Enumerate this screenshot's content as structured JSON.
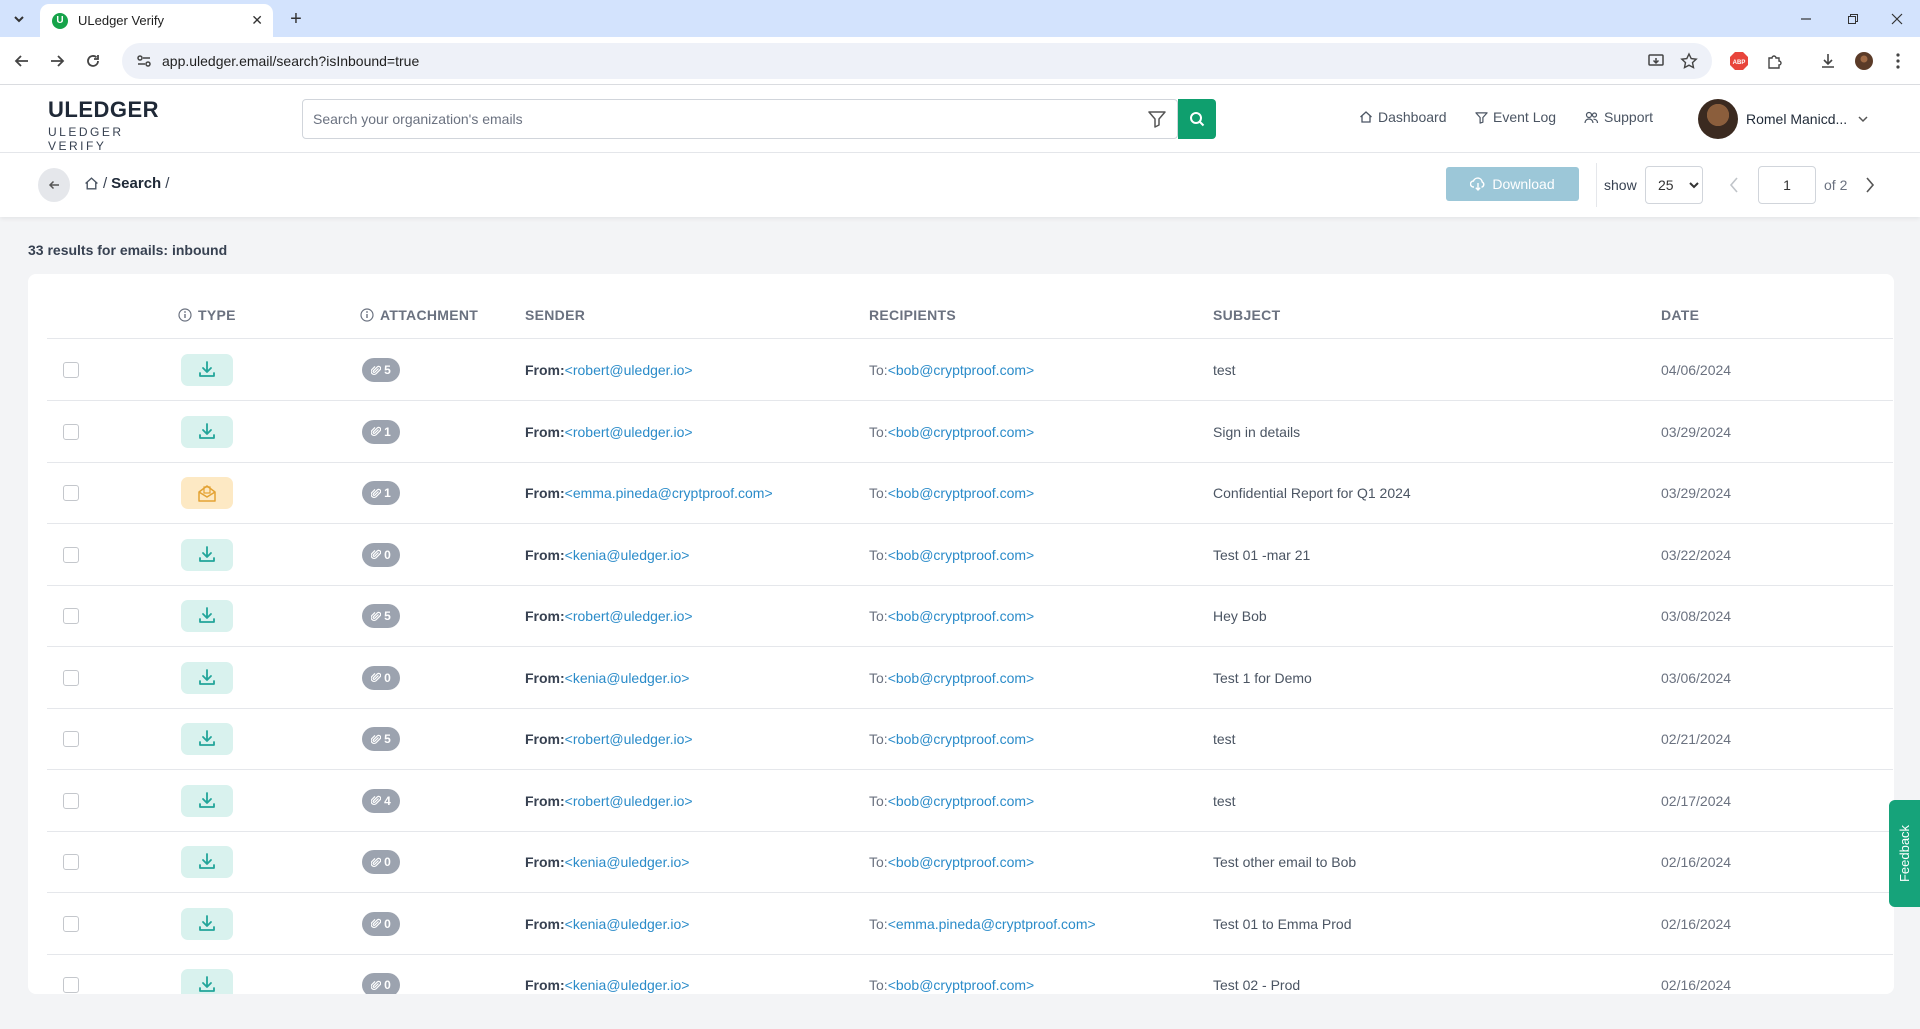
{
  "browser": {
    "tab_title": "ULedger Verify",
    "url": "app.uledger.email/search?isInbound=true"
  },
  "header": {
    "logo_brand": "ULEDGER",
    "logo_sub": "ULEDGER VERIFY",
    "search_placeholder": "Search your organization's emails",
    "nav": {
      "dashboard": "Dashboard",
      "event_log": "Event Log",
      "support": "Support"
    },
    "user_name": "Romel Manicd..."
  },
  "toolbar": {
    "breadcrumb": {
      "sep1": "/",
      "current": "Search",
      "sep2": "/"
    },
    "download_label": "Download",
    "show_label": "show",
    "page_size": "25",
    "page_size_options": [
      "25"
    ],
    "current_page": "1",
    "of_pages": "of 2"
  },
  "results": {
    "summary": "33 results for emails: inbound",
    "columns": {
      "type": "TYPE",
      "attachment": "ATTACHMENT",
      "sender": "SENDER",
      "recipients": "RECIPIENTS",
      "subject": "SUBJECT",
      "date": "DATE"
    },
    "from_prefix": "From:",
    "to_prefix": "To:",
    "rows": [
      {
        "type_icon": "download-icon",
        "attachments": "5",
        "sender": "<robert@uledger.io>",
        "recipient": "<bob@cryptproof.com>",
        "subject": "test",
        "date": "04/06/2024"
      },
      {
        "type_icon": "download-icon",
        "attachments": "1",
        "sender": "<robert@uledger.io>",
        "recipient": "<bob@cryptproof.com>",
        "subject": "Sign in details",
        "date": "03/29/2024"
      },
      {
        "type_icon": "secure-message-icon",
        "attachments": "1",
        "sender": "<emma.pineda@cryptproof.com>",
        "recipient": "<bob@cryptproof.com>",
        "subject": "Confidential Report for Q1 2024",
        "date": "03/29/2024"
      },
      {
        "type_icon": "download-icon",
        "attachments": "0",
        "sender": "<kenia@uledger.io>",
        "recipient": "<bob@cryptproof.com>",
        "subject": "Test 01 -mar 21",
        "date": "03/22/2024"
      },
      {
        "type_icon": "download-icon",
        "attachments": "5",
        "sender": "<robert@uledger.io>",
        "recipient": "<bob@cryptproof.com>",
        "subject": "Hey Bob",
        "date": "03/08/2024"
      },
      {
        "type_icon": "download-icon",
        "attachments": "0",
        "sender": "<kenia@uledger.io>",
        "recipient": "<bob@cryptproof.com>",
        "subject": "Test 1 for Demo",
        "date": "03/06/2024"
      },
      {
        "type_icon": "download-icon",
        "attachments": "5",
        "sender": "<robert@uledger.io>",
        "recipient": "<bob@cryptproof.com>",
        "subject": "test",
        "date": "02/21/2024"
      },
      {
        "type_icon": "download-icon",
        "attachments": "4",
        "sender": "<robert@uledger.io>",
        "recipient": "<bob@cryptproof.com>",
        "subject": "test",
        "date": "02/17/2024"
      },
      {
        "type_icon": "download-icon",
        "attachments": "0",
        "sender": "<kenia@uledger.io>",
        "recipient": "<bob@cryptproof.com>",
        "subject": "Test other email to Bob",
        "date": "02/16/2024"
      },
      {
        "type_icon": "download-icon",
        "attachments": "0",
        "sender": "<kenia@uledger.io>",
        "recipient": "<emma.pineda@cryptproof.com>",
        "subject": "Test 01 to Emma Prod",
        "date": "02/16/2024"
      },
      {
        "type_icon": "download-icon",
        "attachments": "0",
        "sender": "<kenia@uledger.io>",
        "recipient": "<bob@cryptproof.com>",
        "subject": "Test 02 - Prod",
        "date": "02/16/2024"
      }
    ]
  },
  "feedback_label": "Feedback",
  "colors": {
    "accent_green": "#0f9f6e",
    "link_blue": "#2a8bc9",
    "download_button": "#9cc7d8",
    "inbound_badge": "#d9f2ee",
    "secure_badge": "#fde9c4"
  }
}
